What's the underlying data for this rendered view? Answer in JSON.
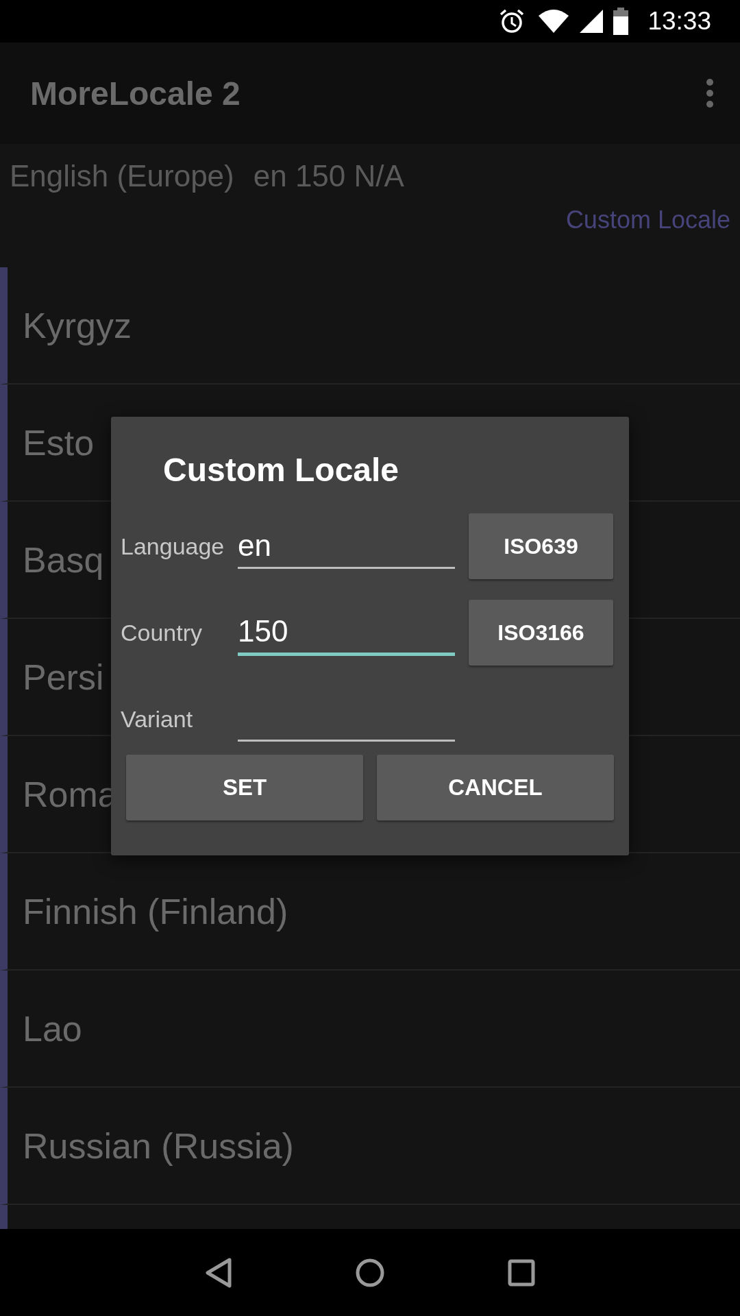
{
  "status_bar": {
    "time": "13:33"
  },
  "app_bar": {
    "title": "MoreLocale 2"
  },
  "current_locale": {
    "name": "English (Europe)",
    "code": "en 150 N/A"
  },
  "custom_locale_link": "Custom Locale",
  "locale_list": [
    {
      "label": "Kyrgyz"
    },
    {
      "label": "Esto"
    },
    {
      "label": "Basq"
    },
    {
      "label": "Persi"
    },
    {
      "label": "Roma"
    },
    {
      "label": "Finnish (Finland)"
    },
    {
      "label": "Lao"
    },
    {
      "label": "Russian (Russia)"
    }
  ],
  "dialog": {
    "title": "Custom Locale",
    "fields": [
      {
        "label": "Language",
        "value": "en",
        "focused": false,
        "button": "ISO639"
      },
      {
        "label": "Country",
        "value": "150",
        "focused": true,
        "button": "ISO3166"
      },
      {
        "label": "Variant",
        "focused": false
      }
    ],
    "buttons": [
      "SET",
      "CANCEL"
    ]
  }
}
